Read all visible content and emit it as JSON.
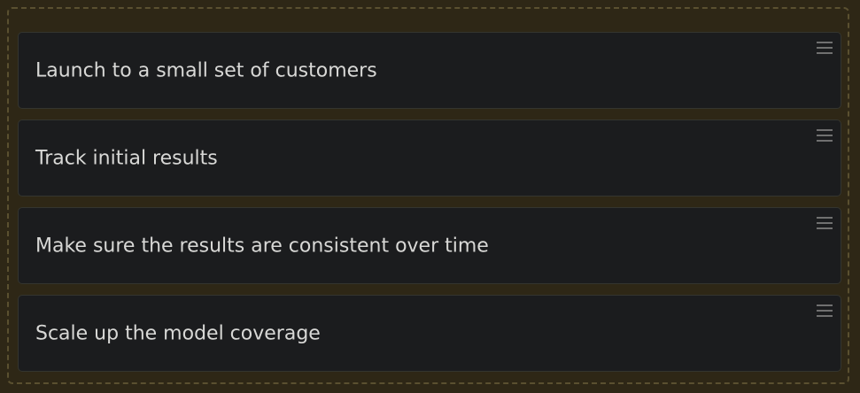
{
  "steps": [
    {
      "label": "Launch to a small set of customers"
    },
    {
      "label": "Track initial results"
    },
    {
      "label": "Make sure the results are consistent over time"
    },
    {
      "label": "Scale up the model coverage"
    }
  ],
  "icons": {
    "drag": "drag-handle-icon"
  },
  "colors": {
    "background": "#2e2716",
    "card": "#1b1c1e",
    "text": "#d8d8d6",
    "handle": "#707070"
  }
}
